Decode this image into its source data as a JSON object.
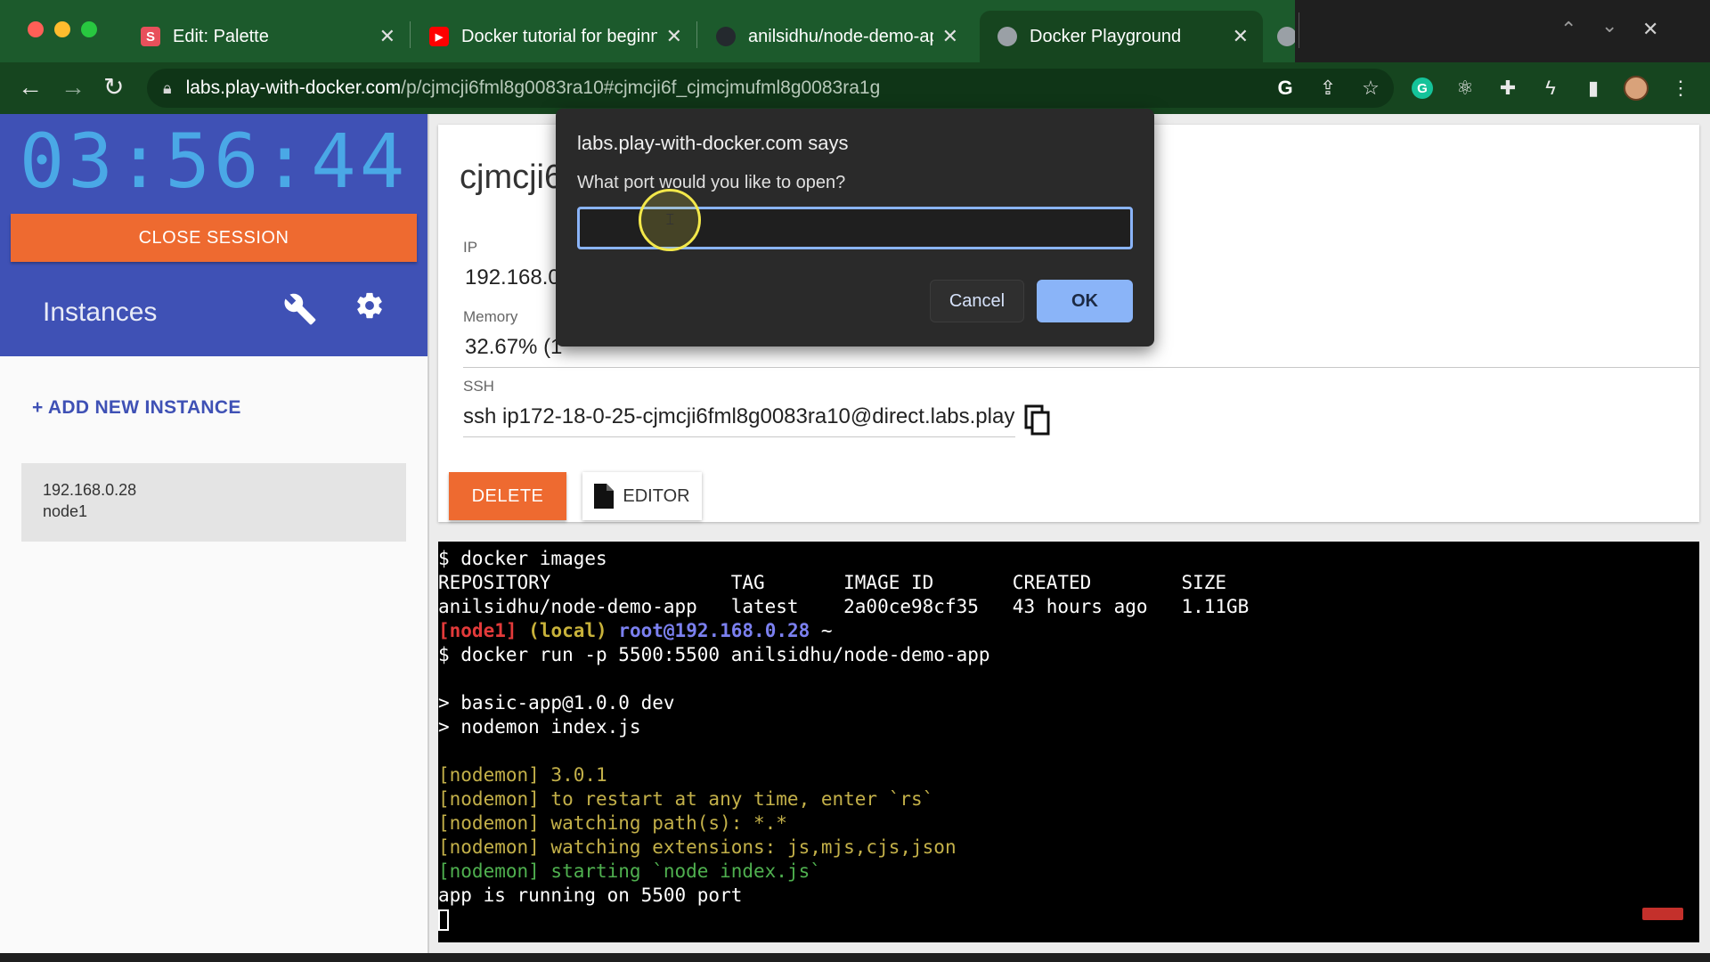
{
  "browser": {
    "tabs": [
      {
        "title": "Edit: Palette",
        "favicon_letter": "S",
        "favicon_color": "#e8505b"
      },
      {
        "title": "Docker tutorial for beginne",
        "favicon_letter": "▶",
        "favicon_color": "#ff0000"
      },
      {
        "title": "anilsidhu/node-demo-app",
        "favicon_letter": "",
        "favicon_color": "#24292e"
      },
      {
        "title": "Docker Playground",
        "favicon_letter": "",
        "favicon_color": "#9aa0a6"
      }
    ],
    "url_host": "labs.play-with-docker.com",
    "url_path": "/p/cjmcji6fml8g0083ra10#cjmcji6f_cjmcjmufml8g0083ra1g"
  },
  "sidebar": {
    "timer": "03:56:44",
    "close_session_label": "CLOSE SESSION",
    "instances_title": "Instances",
    "add_instance_label": "+ ADD NEW INSTANCE",
    "instance": {
      "ip": "192.168.0.28",
      "name": "node1"
    }
  },
  "instance_panel": {
    "node_name": "cjmcji6",
    "ip_label": "IP",
    "ip_value": "192.168.0",
    "memory_label": "Memory",
    "memory_value": "32.67% (1",
    "ssh_label": "SSH",
    "ssh_value": "ssh ip172-18-0-25-cjmcji6fml8g0083ra10@direct.labs.play",
    "delete_label": "DELETE",
    "editor_label": "EDITOR"
  },
  "terminal": {
    "lines": [
      {
        "parts": [
          {
            "text": "$ docker images",
            "cls": ""
          }
        ]
      },
      {
        "parts": [
          {
            "text": "REPOSITORY                TAG       IMAGE ID       CREATED        SIZE",
            "cls": ""
          }
        ]
      },
      {
        "parts": [
          {
            "text": "anilsidhu/node-demo-app   latest    2a00ce98cf35   43 hours ago   1.11GB",
            "cls": ""
          }
        ]
      },
      {
        "parts": [
          {
            "text": "[node1]",
            "cls": "c-red"
          },
          {
            "text": " ",
            "cls": ""
          },
          {
            "text": "(local)",
            "cls": "c-yel"
          },
          {
            "text": " ",
            "cls": ""
          },
          {
            "text": "root@192.168.0.28",
            "cls": "c-blue"
          },
          {
            "text": " ~",
            "cls": ""
          }
        ]
      },
      {
        "parts": [
          {
            "text": "$ docker run -p 5500:5500 anilsidhu/node-demo-app",
            "cls": ""
          }
        ]
      },
      {
        "parts": [
          {
            "text": "",
            "cls": ""
          }
        ]
      },
      {
        "parts": [
          {
            "text": "> basic-app@1.0.0 dev",
            "cls": ""
          }
        ]
      },
      {
        "parts": [
          {
            "text": "> nodemon index.js",
            "cls": ""
          }
        ]
      },
      {
        "parts": [
          {
            "text": "",
            "cls": ""
          }
        ]
      },
      {
        "parts": [
          {
            "text": "[nodemon] 3.0.1",
            "cls": "c-mustard"
          }
        ]
      },
      {
        "parts": [
          {
            "text": "[nodemon] to restart at any time, enter `rs`",
            "cls": "c-mustard"
          }
        ]
      },
      {
        "parts": [
          {
            "text": "[nodemon] watching path(s): *.*",
            "cls": "c-mustard"
          }
        ]
      },
      {
        "parts": [
          {
            "text": "[nodemon] watching extensions: js,mjs,cjs,json",
            "cls": "c-mustard"
          }
        ]
      },
      {
        "parts": [
          {
            "text": "[nodemon] starting `node index.js`",
            "cls": "c-green"
          }
        ]
      },
      {
        "parts": [
          {
            "text": "app is running on 5500 port",
            "cls": ""
          }
        ]
      }
    ]
  },
  "dialog": {
    "title": "labs.play-with-docker.com says",
    "message": "What port would you like to open?",
    "input_value": "",
    "cancel_label": "Cancel",
    "ok_label": "OK"
  },
  "colors": {
    "accent_orange": "#ee6a30",
    "sidebar_blue": "#3f51b5",
    "dialog_button_blue": "#8ab4f8"
  }
}
